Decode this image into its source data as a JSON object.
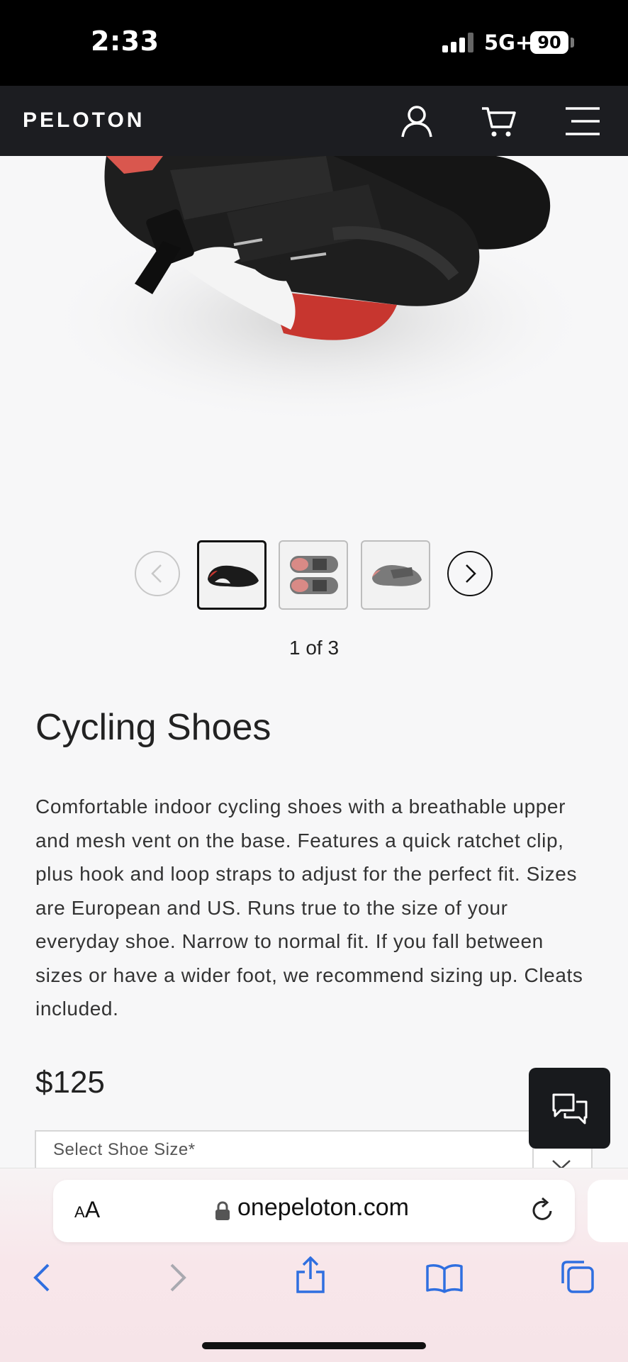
{
  "status_bar": {
    "time": "2:33",
    "network": "5G+",
    "battery": "90"
  },
  "header": {
    "logo": "PELOTON"
  },
  "product": {
    "image_counter": "1 of 3",
    "title": "Cycling Shoes",
    "description": "Comfortable indoor cycling shoes with a breathable upper and mesh vent on the base. Features a quick ratchet clip, plus hook and loop straps to adjust for the perfect fit. Sizes are European and US. Runs true to the size of your everyday shoe. Narrow to normal fit. If you fall between sizes or have a wider foot, we recommend sizing up. Cleats included.",
    "price": "$125",
    "size_select_label": "Select Shoe Size*"
  },
  "browser": {
    "text_size_label": "AA",
    "url": "onepeloton.com"
  },
  "colors": {
    "header_bg": "#1c1d21",
    "accent_red": "#c7362f",
    "chat_bg": "#181a1d"
  }
}
